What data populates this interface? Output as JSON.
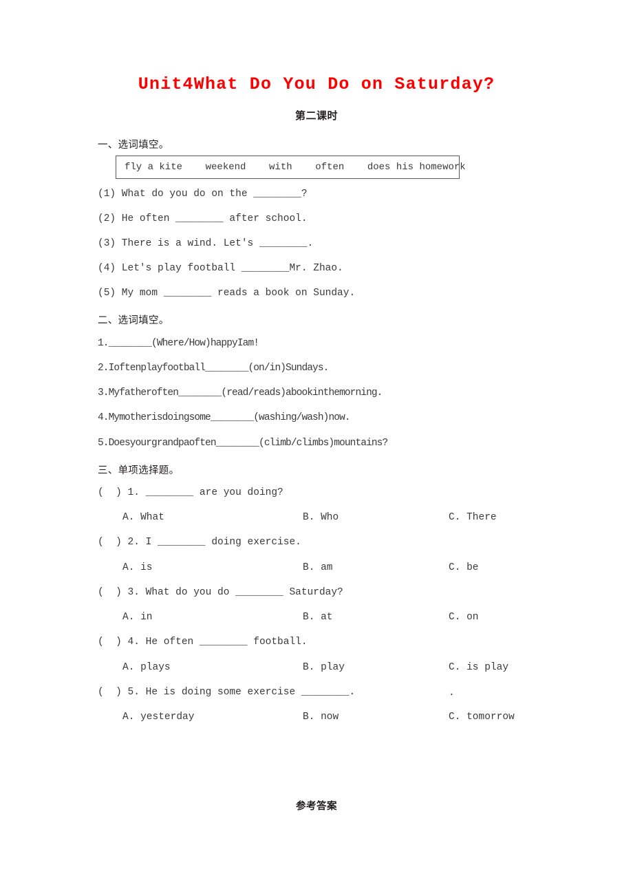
{
  "document": {
    "title": "Unit4What Do You Do on Saturday?",
    "subtitle": "第二课时",
    "footer": "参考答案"
  },
  "section_one": {
    "heading": "一、选词填空。",
    "word_bank": "fly a kite    weekend    with    often    does his homework",
    "items": [
      "(1) What do you do on the ________?",
      "(2) He often ________ after school.",
      "(3) There is a wind. Let's ________.",
      "(4) Let's play football ________Mr. Zhao.",
      "(5) My mom ________ reads a book on Sunday."
    ]
  },
  "section_two": {
    "heading": "二、选词填空。",
    "items": [
      "1.________(Where/How)happyIam!",
      "2.Ioftenplayfootball________(on/in)Sundays.",
      "3.Myfatheroften________(read/reads)abookinthemorning.",
      "4.Mymotherisdoingsome________(washing/wash)now.",
      "5.Doesyourgrandpaoften________(climb/climbs)mountains?"
    ]
  },
  "section_three": {
    "heading": "三、单项选择题。",
    "stray_mark": ".",
    "questions": [
      {
        "stem": "(  ) 1. ________ are you doing?",
        "options": [
          "A. What",
          "B. Who",
          "C. There"
        ]
      },
      {
        "stem": "(  ) 2. I ________ doing exercise.",
        "options": [
          "A. is",
          "B. am",
          "C. be"
        ]
      },
      {
        "stem": "(  ) 3. What do you do ________ Saturday?",
        "options": [
          "A. in",
          "B. at",
          "C. on"
        ]
      },
      {
        "stem": "(  ) 4. He often ________ football.",
        "options": [
          "A. plays",
          "B. play",
          "C. is play"
        ]
      },
      {
        "stem": "(  ) 5. He is doing some exercise ________.",
        "options": [
          "A. yesterday",
          "B. now",
          "C. tomorrow"
        ]
      }
    ]
  }
}
